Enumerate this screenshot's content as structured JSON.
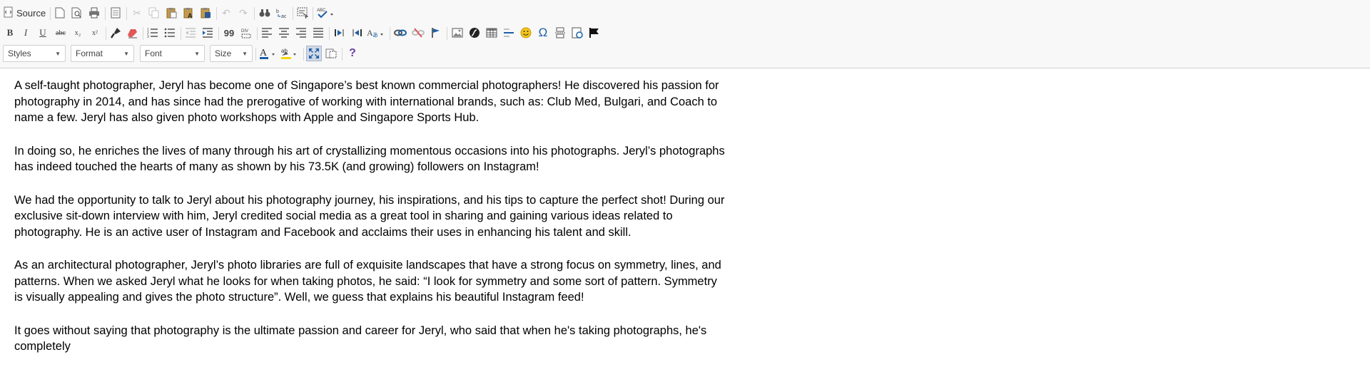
{
  "toolbar": {
    "source_label": "Source",
    "styles_label": "Styles",
    "format_label": "Format",
    "font_label": "Font",
    "size_label": "Size",
    "bold_glyph": "B",
    "italic_glyph": "I",
    "underline_glyph": "U",
    "strike_glyph": "abc",
    "subscript_glyph": "x₂",
    "superscript_glyph": "x²",
    "spellcheck_glyph": "ABC",
    "help_glyph": "?",
    "omega_glyph": "Ω",
    "blockquote_glyph": "99",
    "accent_color": "#1c5fa8"
  },
  "content": {
    "paragraphs": [
      "A self-taught photographer, Jeryl has become one of Singapore’s best known commercial photographers! He discovered his passion for photography in 2014, and has since had the prerogative of working with international brands, such as: Club Med, Bulgari, and Coach to name a few. Jeryl has also given photo workshops with Apple and Singapore Sports Hub.",
      "In doing so, he enriches the lives of many through his art of crystallizing momentous occasions into his photographs. Jeryl’s photographs has indeed touched the hearts of many as shown by his 73.5K (and growing) followers on Instagram!",
      "We had the opportunity to talk to Jeryl about his photography journey, his inspirations, and his tips to capture the perfect shot! During our exclusive sit-down interview with him, Jeryl credited social media as a great tool in sharing and gaining various ideas related to photography. He is an active user of Instagram and Facebook and acclaims their uses in enhancing his talent and skill.",
      "As an architectural photographer, Jeryl’s photo libraries are full of exquisite landscapes that have a strong focus on symmetry, lines, and patterns. When we asked Jeryl what he looks for when taking photos, he said: “I look for symmetry and some sort of pattern. Symmetry is visually appealing and gives the photo structure”. Well, we guess that explains his beautiful Instagram feed!",
      "It goes without saying that photography is the ultimate passion and career for Jeryl, who said that when he's taking photographs, he's completely"
    ]
  }
}
